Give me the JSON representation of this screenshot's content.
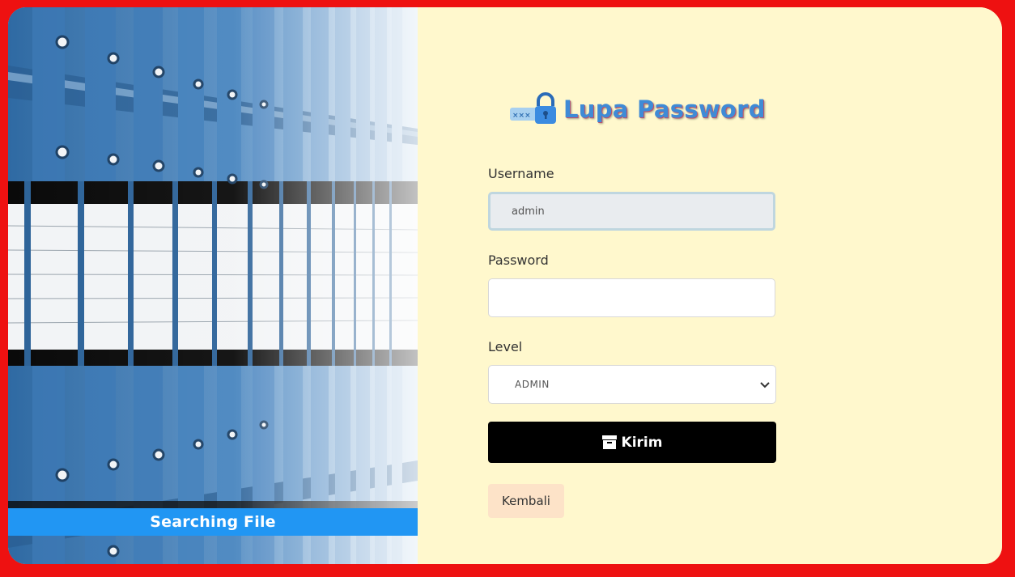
{
  "sidebar": {
    "caption": "Searching File",
    "image_description_icon": "file-cabinet-binders-photo"
  },
  "form": {
    "title": "Lupa Password",
    "title_icon": "password-lock-icon",
    "username": {
      "label": "Username",
      "value": "admin"
    },
    "password": {
      "label": "Password",
      "value": ""
    },
    "level": {
      "label": "Level",
      "selected": "ADMIN"
    },
    "submit_label": "Kirim",
    "submit_icon": "archive-box-icon",
    "back_label": "Kembali"
  },
  "colors": {
    "page_border": "#ee1111",
    "card_background": "#fff8cd",
    "title_blue": "#3f8bd6",
    "caption_bar": "#2196f3",
    "submit_background": "#000000",
    "back_background": "#fde3c8"
  }
}
